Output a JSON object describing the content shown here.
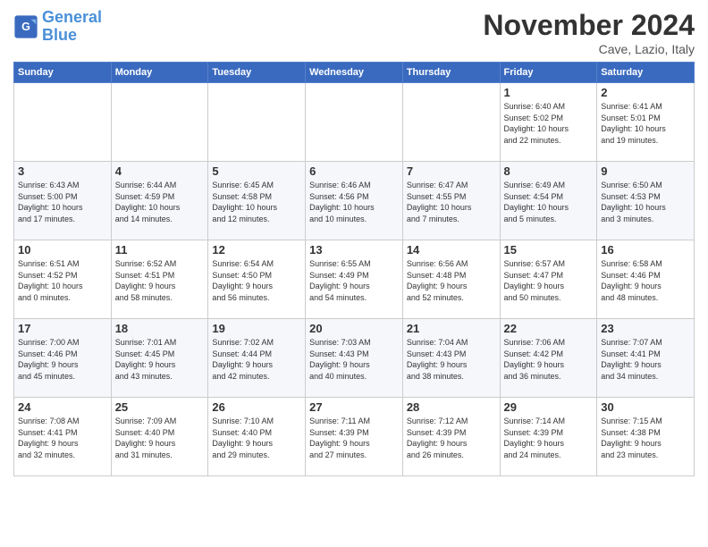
{
  "header": {
    "logo_line1": "General",
    "logo_line2": "Blue",
    "month": "November 2024",
    "location": "Cave, Lazio, Italy"
  },
  "weekdays": [
    "Sunday",
    "Monday",
    "Tuesday",
    "Wednesday",
    "Thursday",
    "Friday",
    "Saturday"
  ],
  "weeks": [
    [
      {
        "day": "",
        "info": ""
      },
      {
        "day": "",
        "info": ""
      },
      {
        "day": "",
        "info": ""
      },
      {
        "day": "",
        "info": ""
      },
      {
        "day": "",
        "info": ""
      },
      {
        "day": "1",
        "info": "Sunrise: 6:40 AM\nSunset: 5:02 PM\nDaylight: 10 hours\nand 22 minutes."
      },
      {
        "day": "2",
        "info": "Sunrise: 6:41 AM\nSunset: 5:01 PM\nDaylight: 10 hours\nand 19 minutes."
      }
    ],
    [
      {
        "day": "3",
        "info": "Sunrise: 6:43 AM\nSunset: 5:00 PM\nDaylight: 10 hours\nand 17 minutes."
      },
      {
        "day": "4",
        "info": "Sunrise: 6:44 AM\nSunset: 4:59 PM\nDaylight: 10 hours\nand 14 minutes."
      },
      {
        "day": "5",
        "info": "Sunrise: 6:45 AM\nSunset: 4:58 PM\nDaylight: 10 hours\nand 12 minutes."
      },
      {
        "day": "6",
        "info": "Sunrise: 6:46 AM\nSunset: 4:56 PM\nDaylight: 10 hours\nand 10 minutes."
      },
      {
        "day": "7",
        "info": "Sunrise: 6:47 AM\nSunset: 4:55 PM\nDaylight: 10 hours\nand 7 minutes."
      },
      {
        "day": "8",
        "info": "Sunrise: 6:49 AM\nSunset: 4:54 PM\nDaylight: 10 hours\nand 5 minutes."
      },
      {
        "day": "9",
        "info": "Sunrise: 6:50 AM\nSunset: 4:53 PM\nDaylight: 10 hours\nand 3 minutes."
      }
    ],
    [
      {
        "day": "10",
        "info": "Sunrise: 6:51 AM\nSunset: 4:52 PM\nDaylight: 10 hours\nand 0 minutes."
      },
      {
        "day": "11",
        "info": "Sunrise: 6:52 AM\nSunset: 4:51 PM\nDaylight: 9 hours\nand 58 minutes."
      },
      {
        "day": "12",
        "info": "Sunrise: 6:54 AM\nSunset: 4:50 PM\nDaylight: 9 hours\nand 56 minutes."
      },
      {
        "day": "13",
        "info": "Sunrise: 6:55 AM\nSunset: 4:49 PM\nDaylight: 9 hours\nand 54 minutes."
      },
      {
        "day": "14",
        "info": "Sunrise: 6:56 AM\nSunset: 4:48 PM\nDaylight: 9 hours\nand 52 minutes."
      },
      {
        "day": "15",
        "info": "Sunrise: 6:57 AM\nSunset: 4:47 PM\nDaylight: 9 hours\nand 50 minutes."
      },
      {
        "day": "16",
        "info": "Sunrise: 6:58 AM\nSunset: 4:46 PM\nDaylight: 9 hours\nand 48 minutes."
      }
    ],
    [
      {
        "day": "17",
        "info": "Sunrise: 7:00 AM\nSunset: 4:46 PM\nDaylight: 9 hours\nand 45 minutes."
      },
      {
        "day": "18",
        "info": "Sunrise: 7:01 AM\nSunset: 4:45 PM\nDaylight: 9 hours\nand 43 minutes."
      },
      {
        "day": "19",
        "info": "Sunrise: 7:02 AM\nSunset: 4:44 PM\nDaylight: 9 hours\nand 42 minutes."
      },
      {
        "day": "20",
        "info": "Sunrise: 7:03 AM\nSunset: 4:43 PM\nDaylight: 9 hours\nand 40 minutes."
      },
      {
        "day": "21",
        "info": "Sunrise: 7:04 AM\nSunset: 4:43 PM\nDaylight: 9 hours\nand 38 minutes."
      },
      {
        "day": "22",
        "info": "Sunrise: 7:06 AM\nSunset: 4:42 PM\nDaylight: 9 hours\nand 36 minutes."
      },
      {
        "day": "23",
        "info": "Sunrise: 7:07 AM\nSunset: 4:41 PM\nDaylight: 9 hours\nand 34 minutes."
      }
    ],
    [
      {
        "day": "24",
        "info": "Sunrise: 7:08 AM\nSunset: 4:41 PM\nDaylight: 9 hours\nand 32 minutes."
      },
      {
        "day": "25",
        "info": "Sunrise: 7:09 AM\nSunset: 4:40 PM\nDaylight: 9 hours\nand 31 minutes."
      },
      {
        "day": "26",
        "info": "Sunrise: 7:10 AM\nSunset: 4:40 PM\nDaylight: 9 hours\nand 29 minutes."
      },
      {
        "day": "27",
        "info": "Sunrise: 7:11 AM\nSunset: 4:39 PM\nDaylight: 9 hours\nand 27 minutes."
      },
      {
        "day": "28",
        "info": "Sunrise: 7:12 AM\nSunset: 4:39 PM\nDaylight: 9 hours\nand 26 minutes."
      },
      {
        "day": "29",
        "info": "Sunrise: 7:14 AM\nSunset: 4:39 PM\nDaylight: 9 hours\nand 24 minutes."
      },
      {
        "day": "30",
        "info": "Sunrise: 7:15 AM\nSunset: 4:38 PM\nDaylight: 9 hours\nand 23 minutes."
      }
    ]
  ]
}
